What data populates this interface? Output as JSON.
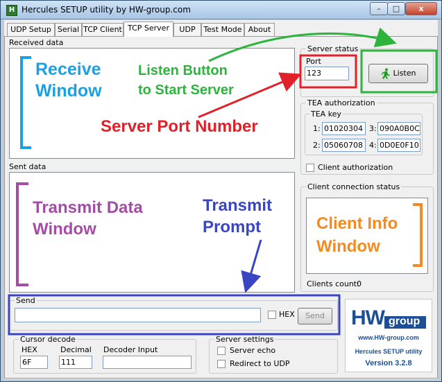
{
  "window": {
    "title": "Hercules SETUP utility by HW-group.com",
    "minimize": "–",
    "maximize": "□",
    "close": "x"
  },
  "tabs": [
    "UDP Setup",
    "Serial",
    "TCP Client",
    "TCP Server",
    "UDP",
    "Test Mode",
    "About"
  ],
  "received": {
    "label": "Received data"
  },
  "sent": {
    "label": "Sent data"
  },
  "server_status": {
    "title": "Server status",
    "port_label": "Port",
    "port_value": "123",
    "listen_label": "Listen"
  },
  "tea": {
    "title": "TEA authorization",
    "key_title": "TEA key",
    "keys": [
      {
        "label": "1:",
        "value": "01020304"
      },
      {
        "label": "3:",
        "value": "090A0B0C"
      },
      {
        "label": "2:",
        "value": "05060708"
      },
      {
        "label": "4:",
        "value": "0D0E0F10"
      }
    ],
    "client_auth": "Client authorization"
  },
  "client_status": {
    "title": "Client connection status",
    "count_label": "Clients count:",
    "count_value": "0"
  },
  "send": {
    "title": "Send",
    "hex_label": "HEX",
    "send_button": "Send"
  },
  "cursor_decode": {
    "title": "Cursor decode",
    "hex_label": "HEX",
    "hex_value": "6F",
    "decimal_label": "Decimal",
    "decimal_value": "111",
    "decoder_label": "Decoder Input",
    "decoder_value": ""
  },
  "server_settings": {
    "title": "Server settings",
    "echo": "Server echo",
    "redirect": "Redirect to UDP"
  },
  "branding": {
    "logo_hw": "HW",
    "logo_group": "group",
    "url": "www.HW-group.com",
    "product": "Hercules SETUP utility",
    "version": "Version  3.2.8"
  },
  "annotations": {
    "receive_window": [
      "Receive",
      "Window"
    ],
    "listen_button": [
      "Listen Button",
      "to Start Server"
    ],
    "server_port": "Server Port Number",
    "transmit_data": [
      "Transmit Data",
      "Window"
    ],
    "transmit_prompt": [
      "Transmit",
      "Prompt"
    ],
    "client_info": [
      "Client Info",
      "Window"
    ]
  },
  "colors": {
    "receive": "#1ba1e2",
    "listen": "#2db43c",
    "port": "#e2202a",
    "transmit_data": "#a54ca6",
    "prompt": "#3a45c4",
    "client_info": "#f58a1f"
  }
}
